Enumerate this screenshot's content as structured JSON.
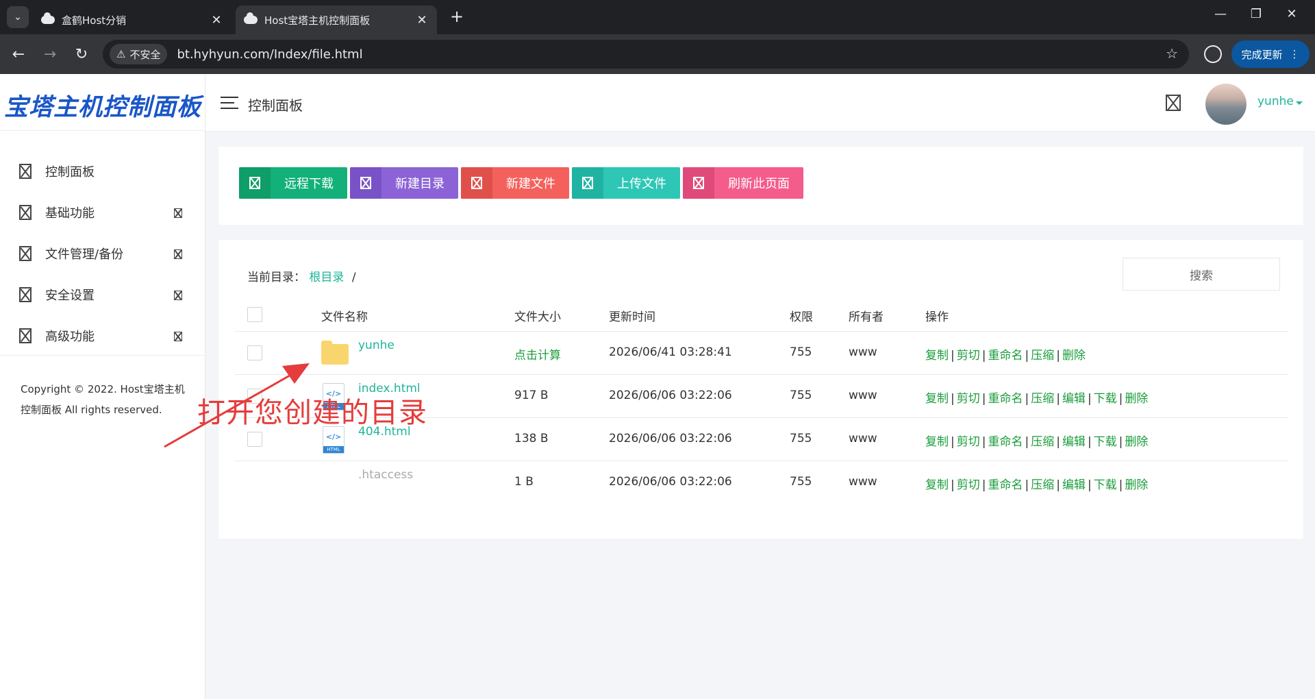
{
  "browser": {
    "tabs": [
      {
        "title": "盒鹤Host分销",
        "close": "✕"
      },
      {
        "title": "Host宝塔主机控制面板",
        "close": "✕"
      }
    ],
    "new_tab": "+",
    "window_controls": {
      "minimize": "—",
      "restore": "❐",
      "close": "✕"
    },
    "security_label": "不安全",
    "url": "bt.hyhyun.com/Index/file.html",
    "update_button": "完成更新"
  },
  "sidebar": {
    "brand": "宝塔主机控制面板",
    "items": [
      {
        "label": "控制面板",
        "has_arrow": false
      },
      {
        "label": "基础功能",
        "has_arrow": true
      },
      {
        "label": "文件管理/备份",
        "has_arrow": true
      },
      {
        "label": "安全设置",
        "has_arrow": true
      },
      {
        "label": "高级功能",
        "has_arrow": true
      }
    ],
    "copyright": "Copyright © 2022. Host宝塔主机控制面板 All rights reserved."
  },
  "header": {
    "title": "控制面板",
    "username": "yunhe"
  },
  "actions": [
    {
      "label": "远程下载",
      "color": "#13b07a",
      "icon_color": "#0f9d69"
    },
    {
      "label": "新建目录",
      "color": "#8b63d6",
      "icon_color": "#7a52c8"
    },
    {
      "label": "新建文件",
      "color": "#f4615c",
      "icon_color": "#e0504b"
    },
    {
      "label": "上传文件",
      "color": "#2ec7b6",
      "icon_color": "#20b3a2"
    },
    {
      "label": "刷新此页面",
      "color": "#f45c8c",
      "icon_color": "#e04a7a"
    }
  ],
  "file_manager": {
    "breadcrumb_label": "当前目录：",
    "breadcrumb_root": "根目录",
    "breadcrumb_sep": "/",
    "search_placeholder": "搜索",
    "columns": {
      "name": "文件名称",
      "size": "文件大小",
      "mtime": "更新时间",
      "perm": "权限",
      "owner": "所有者",
      "ops": "操作"
    },
    "files": [
      {
        "name": "yunhe",
        "type": "folder",
        "size": "点击计算",
        "mtime": "2026/06/41 03:28:41",
        "perm": "755",
        "owner": "www",
        "ops": [
          "复制",
          "剪切",
          "重命名",
          "压缩",
          "删除"
        ]
      },
      {
        "name": "index.html",
        "type": "html",
        "size": "917 B",
        "mtime": "2026/06/06 03:22:06",
        "perm": "755",
        "owner": "www",
        "ops": [
          "复制",
          "剪切",
          "重命名",
          "压缩",
          "编辑",
          "下载",
          "删除"
        ]
      },
      {
        "name": "404.html",
        "type": "html",
        "size": "138 B",
        "mtime": "2026/06/06 03:22:06",
        "perm": "755",
        "owner": "www",
        "ops": [
          "复制",
          "剪切",
          "重命名",
          "压缩",
          "编辑",
          "下载",
          "删除"
        ]
      },
      {
        "name": ".htaccess",
        "type": "file",
        "size": "1 B",
        "mtime": "2026/06/06 03:22:06",
        "perm": "755",
        "owner": "www",
        "ops": [
          "复制",
          "剪切",
          "重命名",
          "压缩",
          "编辑",
          "下载",
          "删除"
        ]
      }
    ]
  },
  "annotation": {
    "text": "打开您创建的目录",
    "color": "#e53c3c"
  }
}
